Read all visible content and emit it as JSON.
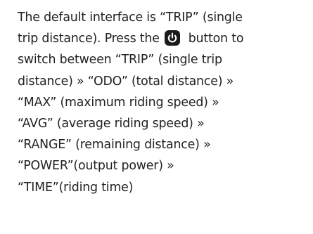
{
  "paragraph": {
    "line1": "The default interface is “TRIP” (single",
    "line2_before_icon": "trip distance). Press the ",
    "line2_icon": "power-icon",
    "line2_after_icon": "  button to",
    "line3": "switch between “TRIP” (single trip",
    "line4": "distance) » “ODO” (total distance) »",
    "line5": "“MAX” (maximum riding speed) »",
    "line6": "“AVG” (average riding speed) »",
    "line7": "“RANGE” (remaining distance) »",
    "line8": "“POWER”(output power) »",
    "line9": "“TIME”(riding time)"
  },
  "colors": {
    "text": "#222222",
    "icon_fill": "#1a1a1a",
    "background": "#ffffff"
  }
}
